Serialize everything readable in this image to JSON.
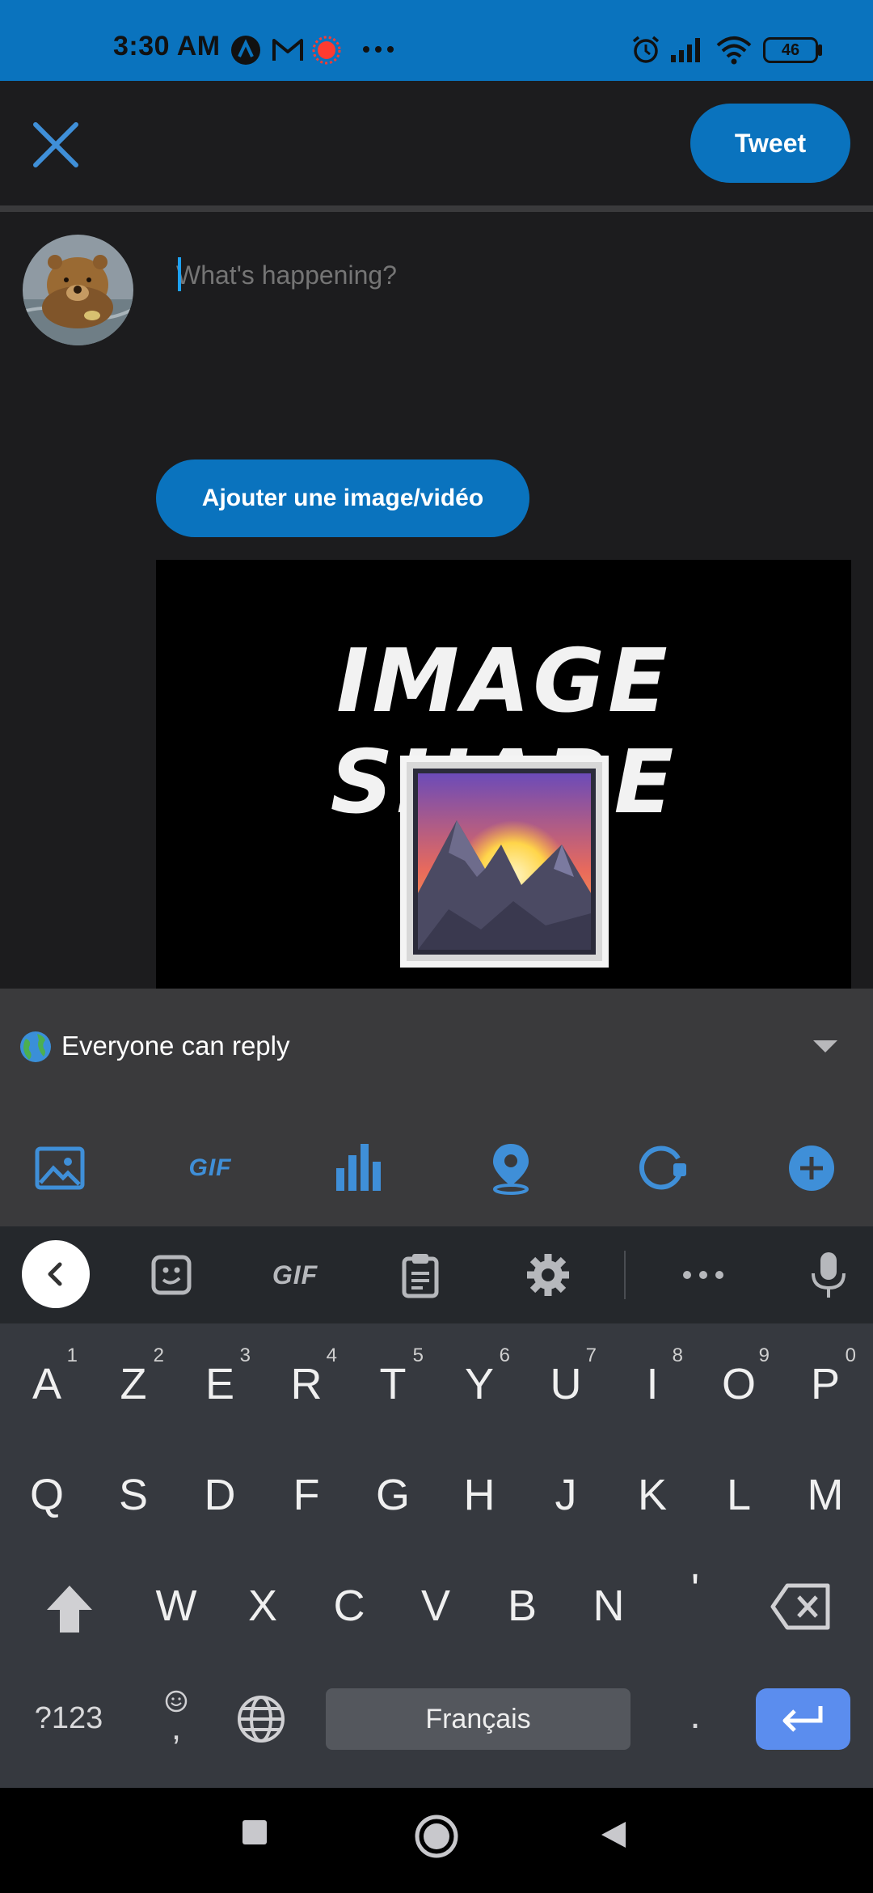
{
  "status_bar": {
    "time": "3:30 AM",
    "battery": "46",
    "icons": [
      "app-a-icon",
      "gmail-icon",
      "record-icon",
      "more-dots-icon",
      "alarm-icon",
      "signal-icon",
      "wifi-icon",
      "battery-icon"
    ],
    "bar_color": "#0a73be"
  },
  "header": {
    "close_icon": "close-icon",
    "tweet_label": "Tweet"
  },
  "compose": {
    "placeholder": "What's happening?",
    "value": "",
    "add_media_label": "Ajouter une image/vidéo",
    "media_title": "IMAGE SHARE",
    "media_image_icon": "sunrise-over-mountains-icon"
  },
  "reply": {
    "icon": "globe-icon",
    "label": "Everyone can reply"
  },
  "toolbar": {
    "items": [
      "image-icon",
      "gif-icon",
      "poll-icon",
      "location-icon",
      "schedule-icon",
      "add-icon"
    ],
    "gif_label": "GIF"
  },
  "keyboard_toolbar": {
    "gif_label": "GIF",
    "items": [
      "back-icon",
      "sticker-icon",
      "gif-icon",
      "clipboard-icon",
      "settings-icon",
      "more-icon",
      "microphone-icon"
    ]
  },
  "keyboard": {
    "row1": [
      {
        "k": "A",
        "h": "1"
      },
      {
        "k": "Z",
        "h": "2"
      },
      {
        "k": "E",
        "h": "3"
      },
      {
        "k": "R",
        "h": "4"
      },
      {
        "k": "T",
        "h": "5"
      },
      {
        "k": "Y",
        "h": "6"
      },
      {
        "k": "U",
        "h": "7"
      },
      {
        "k": "I",
        "h": "8"
      },
      {
        "k": "O",
        "h": "9"
      },
      {
        "k": "P",
        "h": "0"
      }
    ],
    "row2": [
      "Q",
      "S",
      "D",
      "F",
      "G",
      "H",
      "J",
      "K",
      "L",
      "M"
    ],
    "row3": [
      "W",
      "X",
      "C",
      "V",
      "B",
      "N",
      "'"
    ],
    "symbols_label": "?123",
    "comma_label": ",",
    "period_label": ".",
    "space_label": "Français",
    "accent": "#5b8dee"
  },
  "nav": {
    "items": [
      "recents-icon",
      "home-icon",
      "back-triangle-icon"
    ]
  }
}
